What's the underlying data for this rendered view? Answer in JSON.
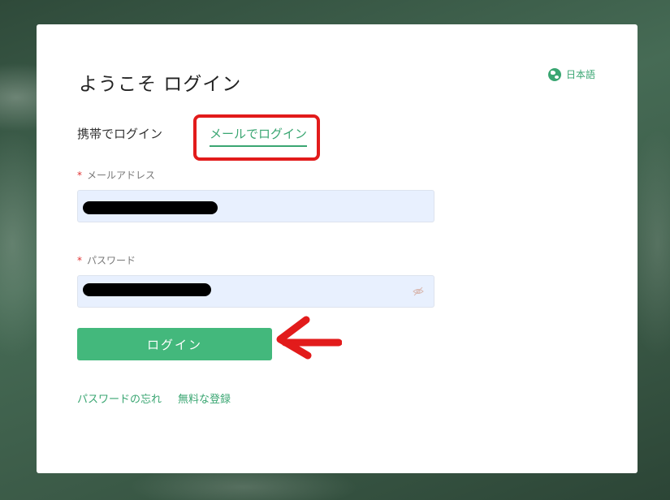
{
  "login": {
    "title": "ようこそ ログイン",
    "language": "日本語",
    "tabs": {
      "phone": "携帯でログイン",
      "email": "メールでログイン"
    },
    "email_label": "メールアドレス",
    "password_label": "パスワード",
    "required_mark": "*",
    "submit_label": "ログイン",
    "forgot_password": "パスワードの忘れ",
    "register": "無料な登録"
  },
  "colors": {
    "accent": "#43b87c",
    "link": "#3aa672",
    "annotation": "#e21b1b"
  }
}
